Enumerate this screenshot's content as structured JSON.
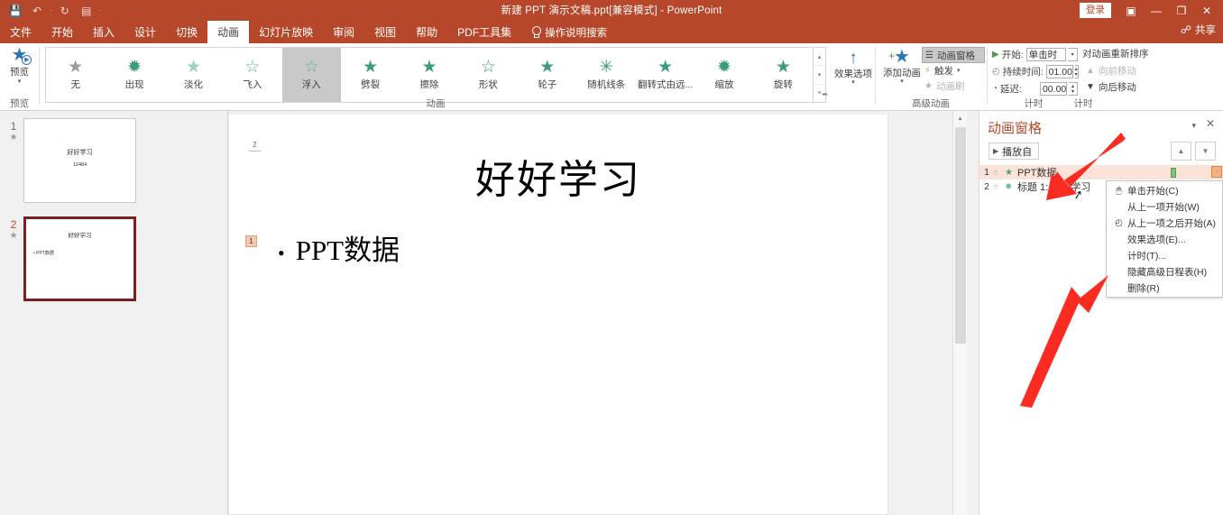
{
  "titlebar": {
    "document_title": "新建 PPT 演示文稿.ppt[兼容模式]  -  PowerPoint",
    "quick_access": [
      {
        "name": "save-icon",
        "glyph": "💾"
      },
      {
        "name": "undo-icon",
        "glyph": "↶"
      },
      {
        "name": "qat-separator",
        "glyph": "·"
      },
      {
        "name": "redo-icon",
        "glyph": "↻"
      },
      {
        "name": "present-icon",
        "glyph": "▤"
      },
      {
        "name": "qat-more-icon",
        "glyph": "·"
      }
    ],
    "signin_label": "登录",
    "ribbon_display_glyph": "▣",
    "minimize_glyph": "—",
    "restore_glyph": "❐",
    "close_glyph": "✕",
    "share_label": "共享",
    "share_icon_glyph": "☍"
  },
  "tabs": [
    {
      "label": "文件",
      "active": false
    },
    {
      "label": "开始",
      "active": false
    },
    {
      "label": "插入",
      "active": false
    },
    {
      "label": "设计",
      "active": false
    },
    {
      "label": "切换",
      "active": false
    },
    {
      "label": "动画",
      "active": true
    },
    {
      "label": "幻灯片放映",
      "active": false
    },
    {
      "label": "审阅",
      "active": false
    },
    {
      "label": "视图",
      "active": false
    },
    {
      "label": "帮助",
      "active": false
    },
    {
      "label": "PDF工具集",
      "active": false
    }
  ],
  "tell_me": {
    "label": "操作说明搜索"
  },
  "ribbon": {
    "preview_group": {
      "button_label": "预览",
      "group_label": "预览",
      "caret": "▾",
      "star_glyph": "★",
      "play_glyph": "▶"
    },
    "animation_group": {
      "group_label": "动画",
      "items": [
        {
          "label": "无",
          "glyph": "★",
          "color": "#9b9b9b",
          "selected": false
        },
        {
          "label": "出现",
          "glyph": "✹",
          "color": "#3d9b7a",
          "selected": false
        },
        {
          "label": "淡化",
          "glyph": "★",
          "color": "#9dd0bd",
          "selected": false
        },
        {
          "label": "飞入",
          "glyph": "☆",
          "color": "#62b396",
          "selected": false
        },
        {
          "label": "浮入",
          "glyph": "☆",
          "color": "#62b396",
          "selected": true
        },
        {
          "label": "劈裂",
          "glyph": "★",
          "color": "#3d9b7a",
          "selected": false
        },
        {
          "label": "擦除",
          "glyph": "★",
          "color": "#3d9b7a",
          "selected": false
        },
        {
          "label": "形状",
          "glyph": "☆",
          "color": "#3d9b7a",
          "selected": false
        },
        {
          "label": "轮子",
          "glyph": "★",
          "color": "#3d9b7a",
          "selected": false
        },
        {
          "label": "随机线条",
          "glyph": "✳",
          "color": "#3d9b7a",
          "selected": false
        },
        {
          "label": "翻转式由远...",
          "glyph": "★",
          "color": "#3d9b7a",
          "selected": false
        },
        {
          "label": "缩放",
          "glyph": "✹",
          "color": "#3d9b7a",
          "selected": false
        },
        {
          "label": "旋转",
          "glyph": "★",
          "color": "#3d9b7a",
          "selected": false
        }
      ],
      "scroll_up": "▴",
      "scroll_down": "▾",
      "scroll_more": "≡"
    },
    "effect_options": {
      "label": "效果选项",
      "glyph": "↑",
      "caret": "▾"
    },
    "advanced_group": {
      "group_label": "高级动画",
      "add_animation": {
        "label": "添加动画",
        "glyph": "★",
        "plus": "+",
        "caret": "▾"
      },
      "rows": [
        {
          "label": "动画窗格",
          "icon": "☰",
          "state": "active"
        },
        {
          "label": "触发",
          "icon": "⚡",
          "state": "normal",
          "caret": "▾"
        },
        {
          "label": "动画刷",
          "icon": "★",
          "state": "disabled"
        }
      ]
    },
    "timing_group": {
      "group_label": "计时",
      "start": {
        "label": "开始:",
        "value": "单击时",
        "icon": "▶",
        "caret": "▾"
      },
      "duration": {
        "label": "持续时间:",
        "value": "01.00",
        "icon": "◴"
      },
      "delay": {
        "label": "延迟:",
        "value": "00.00",
        "icon": "◔"
      }
    },
    "reorder_group": {
      "title": "对动画重新排序",
      "move_earlier": {
        "label": "向前移动",
        "glyph": "▲",
        "disabled": true
      },
      "move_later": {
        "label": "向后移动",
        "glyph": "▼",
        "disabled": false
      }
    },
    "dialog_launcher_glyph": "⬌"
  },
  "thumbnails": [
    {
      "number": "1",
      "star": "★",
      "selected": false,
      "title": "好好学习",
      "subtitle": "12484"
    },
    {
      "number": "2",
      "star": "★",
      "selected": true,
      "title": "好好学习",
      "bullet": "• PPT数据"
    }
  ],
  "slide": {
    "title": "好好学习",
    "title_tag": "2",
    "body_bullet": "•",
    "body_text": "PPT数据",
    "body_tag": "1"
  },
  "animation_pane": {
    "title": "动画窗格",
    "minimize_glyph": "▾",
    "close_glyph": "✕",
    "play_from": {
      "label": "播放自",
      "glyph": "▶"
    },
    "move_up_glyph": "▲",
    "move_down_glyph": "▼",
    "items": [
      {
        "index": "1",
        "mouse": "☝",
        "star": "★",
        "star_color": "#4a9e7e",
        "name": "PPT数据",
        "selected": true,
        "expand": "·"
      },
      {
        "index": "2",
        "mouse": "☝",
        "star": "✹",
        "star_color": "#6fbf9e",
        "name": "标题 1: 好好学习",
        "selected": false
      }
    ]
  },
  "context_menu": {
    "items": [
      {
        "label": "单击开始(C)",
        "icon": "🖱"
      },
      {
        "label": "从上一项开始(W)",
        "icon": ""
      },
      {
        "label": "从上一项之后开始(A)",
        "icon": "◴"
      },
      {
        "label": "效果选项(E)...",
        "icon": ""
      },
      {
        "label": "计时(T)...",
        "icon": ""
      },
      {
        "label": "隐藏高级日程表(H)",
        "icon": ""
      },
      {
        "label": "删除(R)",
        "icon": ""
      }
    ]
  },
  "scrollbar": {
    "up_glyph": "▴",
    "down_glyph": "▾"
  },
  "colors": {
    "ribbon_red": "#b7472a",
    "selected_slide_border": "#7b1f23",
    "pane_row_selected": "#fbe3d8",
    "annotation_arrow": "#fc2b21",
    "anim_bar_green": "#7bc47b"
  }
}
